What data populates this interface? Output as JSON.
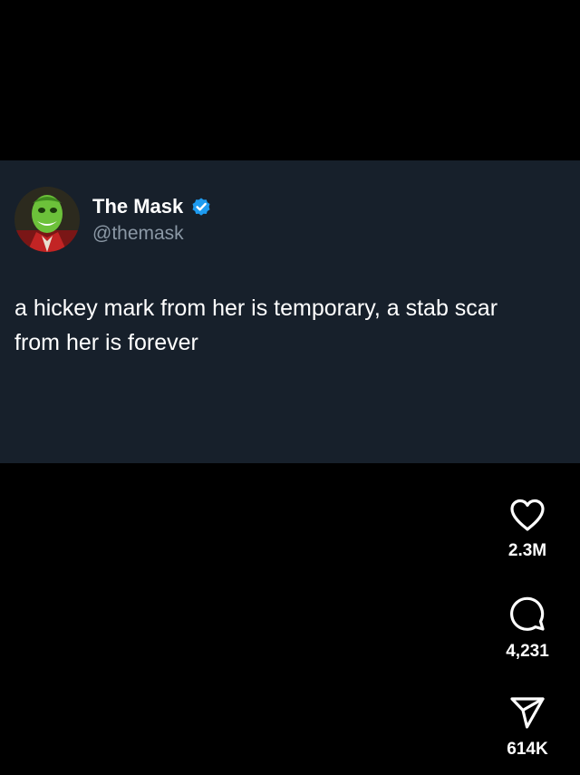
{
  "tweet": {
    "author_name": "The Mask",
    "author_handle": "@themask",
    "verified": true,
    "text": "a hickey mark from her is temporary, a stab scar from her is forever"
  },
  "actions": {
    "likes": "2.3M",
    "comments": "4,231",
    "shares": "614K"
  },
  "icons": {
    "verified": "verified-badge-icon",
    "like": "heart-icon",
    "comment": "speech-bubble-icon",
    "share": "paper-plane-icon"
  },
  "colors": {
    "background": "#000000",
    "card_background": "#17202b",
    "handle_text": "#8b98a5",
    "verified_blue": "#1d9bf0",
    "text": "#ffffff"
  }
}
